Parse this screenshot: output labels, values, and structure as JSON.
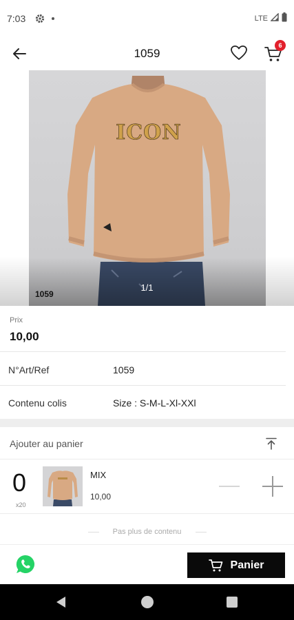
{
  "status": {
    "time": "7:03",
    "network": "LTE"
  },
  "header": {
    "title": "1059",
    "cart_count": "6"
  },
  "product": {
    "photo_code": "1059",
    "photo_print": "ICON",
    "page_indicator": "1/1",
    "price_label": "Prix",
    "price_value": "10,00",
    "ref_label": "N°Art/Ref",
    "ref_value": "1059",
    "content_label": "Contenu colis",
    "content_value": "Size : S-M-L-Xl-XXl"
  },
  "cart_panel": {
    "title": "Ajouter au panier",
    "quantity": "0",
    "unit": "x20",
    "item_name": "MIX",
    "item_price": "10,00"
  },
  "footer": {
    "end_note": "Pas plus de contenu",
    "cart_button": "Panier"
  },
  "colors": {
    "accent": "#e2202c",
    "cta": "#0a0a0a",
    "whatsapp": "#25d366",
    "sweater": "#d8a983"
  }
}
